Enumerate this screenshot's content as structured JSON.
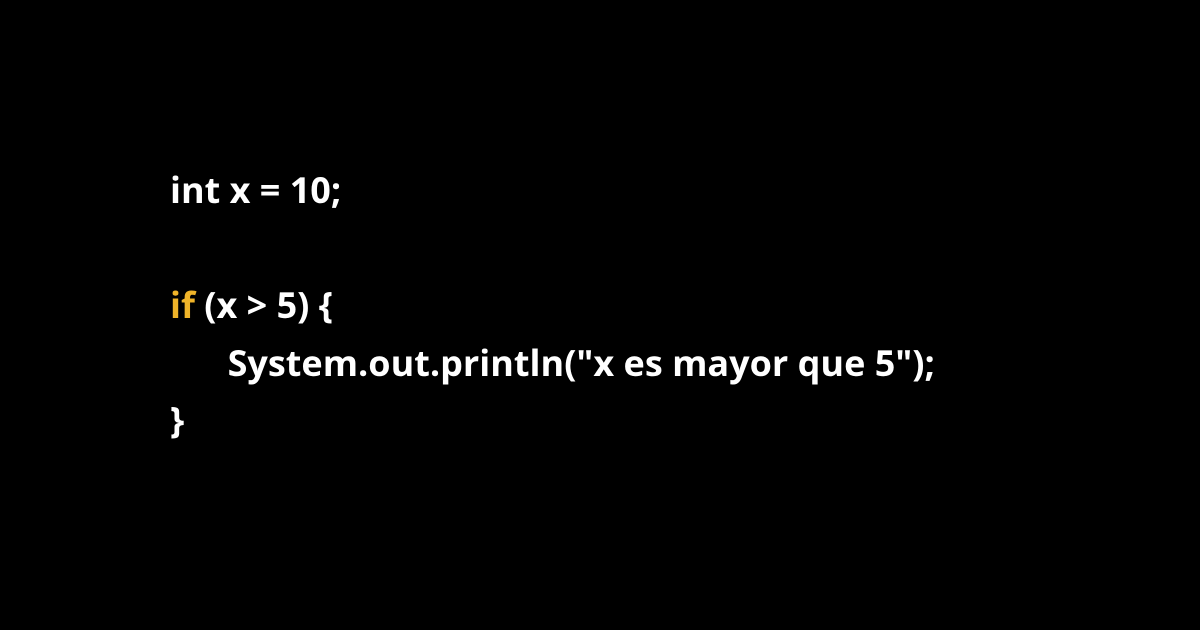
{
  "code": {
    "line1": "int x = 10;",
    "line3_keyword": "if",
    "line3_rest": " (x > 5) {",
    "line4_indent": "    ",
    "line4_text": "System.out.println(\"x es mayor que 5\");",
    "line5": "}"
  },
  "colors": {
    "keyword": "#f0b429",
    "text": "#ffffff",
    "bg": "#000000"
  }
}
